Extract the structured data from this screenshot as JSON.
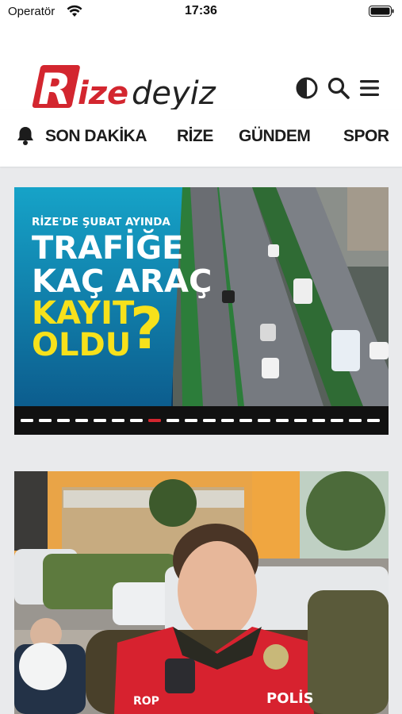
{
  "status_bar": {
    "carrier": "Operatör",
    "time": "17:36"
  },
  "header": {
    "logo_text_r": "R",
    "logo_text_ize": "ize",
    "logo_text_deyiz": "deyiz",
    "brand_color": "#d3262f",
    "icons": [
      "contrast-icon",
      "search-icon",
      "menu-icon"
    ]
  },
  "nav": {
    "items": [
      {
        "label": "SON DAKİKA",
        "icon": "bell-icon"
      },
      {
        "label": "RİZE"
      },
      {
        "label": "GÜNDEM"
      },
      {
        "label": "SPOR"
      }
    ]
  },
  "articles": [
    {
      "image_text": {
        "kicker": "RİZE'DE ŞUBAT AYINDA",
        "line1": "TRAFİĞE",
        "line2": "KAÇ ARAÇ",
        "line3": "KAYIT",
        "line4": "OLDU",
        "mark": "?"
      },
      "slider_dots": 20,
      "active_dot": 7
    },
    {
      "image_text": {
        "badge_left": "ROP",
        "badge_right": "POLİS"
      }
    }
  ]
}
